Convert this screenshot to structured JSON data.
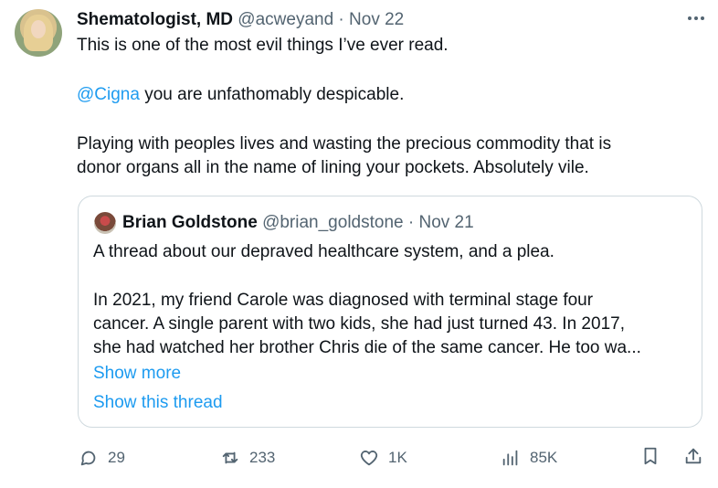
{
  "tweet": {
    "author_name": "Shematologist, MD",
    "handle": "@acweyand",
    "separator": "·",
    "date": "Nov 22",
    "line1": "This is one of the most evil things I’ve ever read.",
    "mention": "@Cigna",
    "line2_rest": " you are unfathomably despicable.",
    "line3": "Playing with peoples lives and wasting the precious commodity that is",
    "line4": "donor organs all in the name of lining your pockets. Absolutely vile.",
    "more_icon": "more-horizontal-icon"
  },
  "quote": {
    "author_name": "Brian Goldstone",
    "handle": "@brian_goldstone",
    "separator": "·",
    "date": "Nov 21",
    "line1": "A thread about our depraved healthcare system, and a plea.",
    "line2": "In 2021, my friend Carole was diagnosed with terminal stage four",
    "line3": "cancer. A single parent with two kids, she had just turned 43. In 2017,",
    "line4": "she had watched her brother Chris die of the same cancer. He too wa...",
    "show_more": "Show more",
    "show_thread": "Show this thread"
  },
  "actions": {
    "replies": "29",
    "reposts": "233",
    "likes": "1K",
    "views": "85K"
  },
  "colors": {
    "accent": "#1d9bf0",
    "muted": "#536471",
    "border": "#cfd9de"
  }
}
